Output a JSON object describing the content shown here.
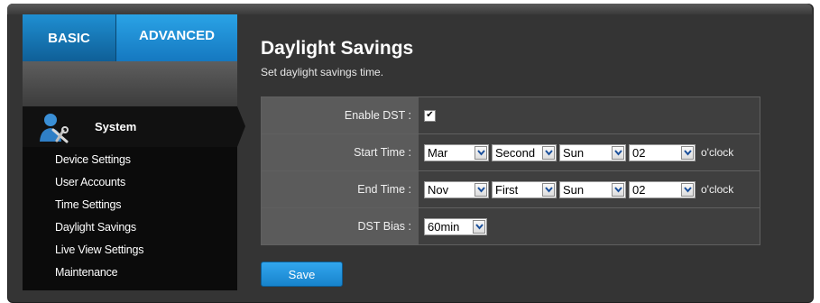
{
  "tabs": {
    "basic": "BASIC",
    "advanced": "ADVANCED"
  },
  "sidebar": {
    "section_title": "System",
    "section_icon": "wrench-user-icon",
    "items": [
      {
        "label": "Device Settings"
      },
      {
        "label": "User Accounts"
      },
      {
        "label": "Time Settings"
      },
      {
        "label": "Daylight Savings"
      },
      {
        "label": "Live View Settings"
      },
      {
        "label": "Maintenance"
      }
    ]
  },
  "main": {
    "title": "Daylight Savings",
    "subtitle": "Set daylight savings time.",
    "enable_dst": {
      "label": "Enable DST :",
      "checked": true,
      "mark": "✔"
    },
    "start_time": {
      "label": "Start Time :",
      "month": "Mar",
      "week": "Second",
      "day": "Sun",
      "hour": "02",
      "suffix": "o'clock"
    },
    "end_time": {
      "label": "End Time :",
      "month": "Nov",
      "week": "First",
      "day": "Sun",
      "hour": "02",
      "suffix": "o'clock"
    },
    "dst_bias": {
      "label": "DST Bias :",
      "value": "60min"
    },
    "save_label": "Save"
  },
  "colors": {
    "accent": "#1f8fd2",
    "panel": "#343434",
    "sidebar": "#0b0b0b"
  }
}
